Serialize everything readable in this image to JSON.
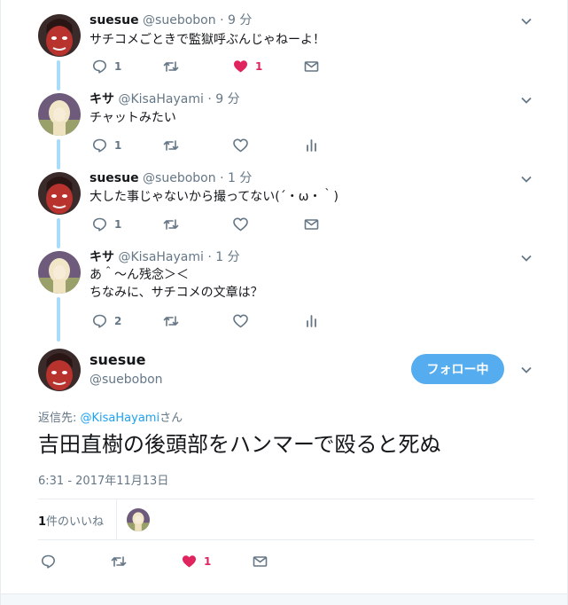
{
  "thread": [
    {
      "name": "suesue",
      "handle": "@suebobon",
      "time": "9 分",
      "lines": [
        "サチコメごときで監獄呼ぶんじゃねーよ！"
      ],
      "actions": {
        "reply_count": "1",
        "retweet_count": "",
        "like_count": "1",
        "liked": true,
        "last_icon": "mail-icon"
      }
    },
    {
      "name": "キサ",
      "handle": "@KisaHayami",
      "time": "9 分",
      "lines": [
        "チャットみたい"
      ],
      "actions": {
        "reply_count": "1",
        "retweet_count": "",
        "like_count": "",
        "liked": false,
        "last_icon": "analytics-icon"
      }
    },
    {
      "name": "suesue",
      "handle": "@suebobon",
      "time": "1 分",
      "lines": [
        "大した事じゃないから撮ってない(´・ω・｀)"
      ],
      "actions": {
        "reply_count": "1",
        "retweet_count": "",
        "like_count": "",
        "liked": false,
        "last_icon": "mail-icon"
      }
    },
    {
      "name": "キサ",
      "handle": "@KisaHayami",
      "time": "1 分",
      "lines": [
        "あ＾〜ん残念＞＜",
        "ちなみに、サチコメの文章は？"
      ],
      "actions": {
        "reply_count": "2",
        "retweet_count": "",
        "like_count": "",
        "liked": false,
        "last_icon": "analytics-icon"
      }
    }
  ],
  "main_tweet": {
    "name": "suesue",
    "handle": "@suebobon",
    "follow_label": "フォロー中",
    "reply_prefix": "返信先: ",
    "reply_link": "@KisaHayami",
    "reply_suffix": "さん",
    "text": "吉田直樹の後頭部をハンマーで殴ると死ぬ",
    "timestamp": "6:31 - 2017年11月13日",
    "likes_number": "1",
    "likes_label": "件のいいね",
    "actions": {
      "reply_count": "",
      "retweet_count": "",
      "like_count": "1",
      "liked": true,
      "last_icon": "mail-icon"
    }
  },
  "colors": {
    "accent": "#1da1f2",
    "follow_button": "#55acee",
    "like": "#e0245e",
    "muted_text": "#657786",
    "thread_line": "#a9dcfa"
  }
}
